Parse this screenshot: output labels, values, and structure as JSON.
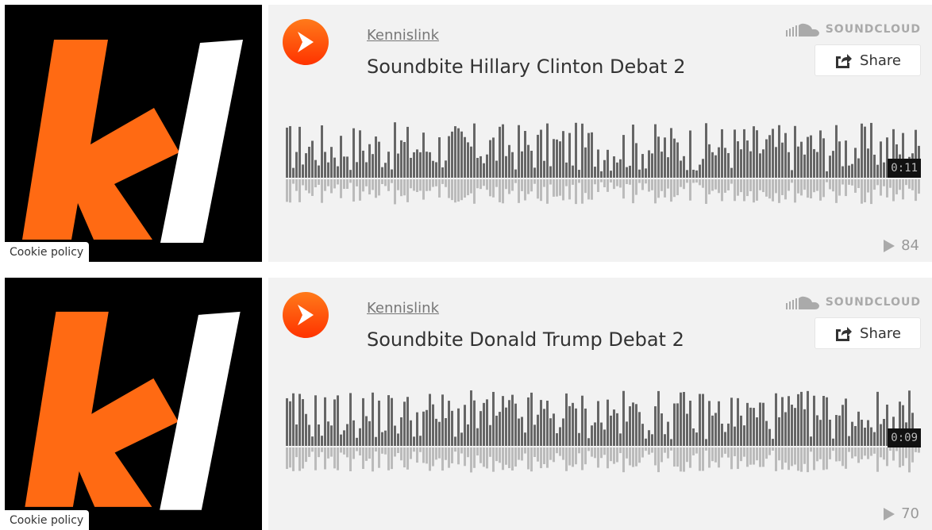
{
  "players": [
    {
      "uploader": "Kennislink",
      "title": "Soundbite Hillary Clinton Debat 2",
      "duration": "0:11",
      "plays": "84",
      "cookie": "Cookie policy",
      "share_label": "Share",
      "brand": "SOUNDCLOUD",
      "icons": [
        "play-icon",
        "share-icon",
        "soundcloud-logo-icon",
        "plays-icon"
      ]
    },
    {
      "uploader": "Kennislink",
      "title": "Soundbite Donald Trump Debat 2",
      "duration": "0:09",
      "plays": "70",
      "cookie": "Cookie policy",
      "share_label": "Share",
      "brand": "SOUNDCLOUD",
      "icons": [
        "play-icon",
        "share-icon",
        "soundcloud-logo-icon",
        "plays-icon"
      ]
    }
  ],
  "colors": {
    "accent": "#ff5500",
    "artwork_bg": "#000000",
    "logo_orange": "#ff6a13",
    "waveform": "#666666",
    "panel_bg": "#f2f2f2"
  }
}
